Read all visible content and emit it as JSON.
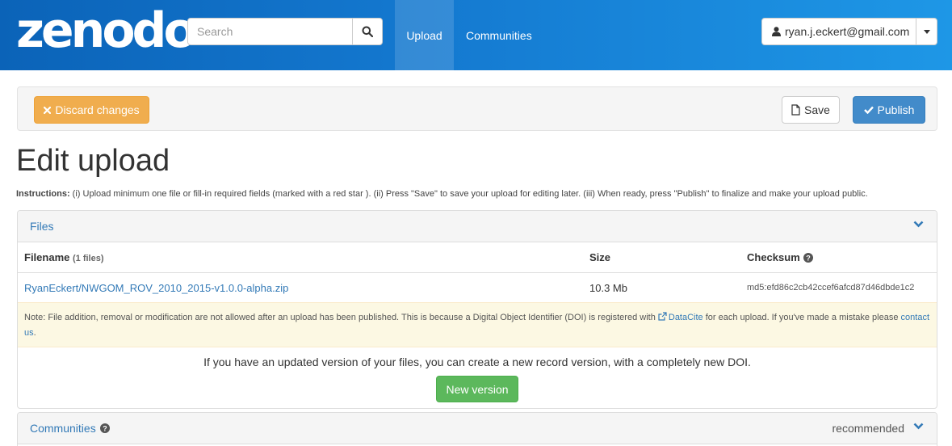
{
  "header": {
    "logo": "zenodo",
    "search_placeholder": "Search",
    "nav_upload": "Upload",
    "nav_communities": "Communities",
    "user_email": "ryan.j.eckert@gmail.com"
  },
  "toolbar": {
    "discard_label": "Discard changes",
    "save_label": "Save",
    "publish_label": "Publish"
  },
  "page_title": "Edit upload",
  "instructions": {
    "label": "Instructions:",
    "text": " (i) Upload minimum one file or fill-in required fields (marked with a red star ). (ii) Press \"Save\" to save your upload for editing later. (iii) When ready, press \"Publish\" to finalize and make your upload public."
  },
  "files_panel": {
    "title": "Files",
    "columns": {
      "filename": "Filename",
      "filename_count": "(1 files)",
      "size": "Size",
      "checksum": "Checksum"
    },
    "rows": [
      {
        "filename": "RyanEckert/NWGOM_ROV_2010_2015-v1.0.0-alpha.zip",
        "size": "10.3 Mb",
        "checksum": "md5:efd86c2cb42ccef6afcd87d46dbde1c2"
      }
    ],
    "note": {
      "text_before": "Note: File addition, removal or modification are not allowed after an upload has been published. This is because a Digital Object Identifier (DOI) is registered with ",
      "datacite_link": "DataCite",
      "text_middle": " for each upload. If you've made a mistake please ",
      "contact_link": "contact us",
      "text_after": "."
    },
    "new_version_text": "If you have an updated version of your files, you can create a new record version, with a completely new DOI.",
    "new_version_button": "New version"
  },
  "communities_panel": {
    "title": "Communities",
    "badge": "recommended"
  },
  "colors": {
    "navbar": "#1479d0",
    "discard": "#f0ad4e",
    "publish": "#428bca",
    "new_version": "#5cb85c",
    "link": "#337ab7"
  }
}
